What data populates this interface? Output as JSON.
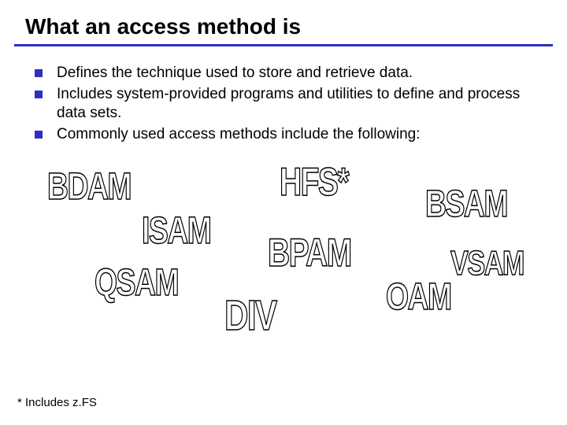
{
  "title": "What an access method is",
  "bullets": [
    "Defines the technique used to store and retrieve data.",
    "Includes system-provided programs and utilities to define and process data sets.",
    "Commonly used access methods include the following:"
  ],
  "methods": {
    "bdam": "BDAM",
    "hfs": "HFS*",
    "bsam": "BSAM",
    "isam": "ISAM",
    "bpam": "BPAM",
    "vsam": "VSAM",
    "qsam": "QSAM",
    "oam": "OAM",
    "div": "DIV"
  },
  "footnote": "* Includes z.FS"
}
